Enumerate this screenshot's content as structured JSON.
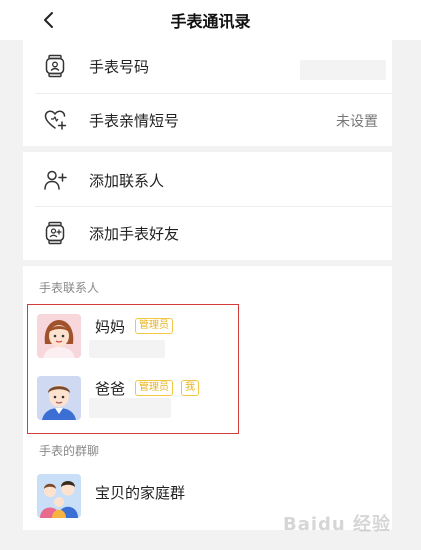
{
  "header": {
    "title": "手表通讯录"
  },
  "settings": {
    "watch_number_label": "手表号码",
    "family_short_number_label": "手表亲情短号",
    "family_short_number_value": "未设置"
  },
  "actions": {
    "add_contact_label": "添加联系人",
    "add_watch_friend_label": "添加手表好友"
  },
  "contacts": {
    "section_title": "手表联系人",
    "items": [
      {
        "name": "妈妈",
        "badges": [
          "管理员"
        ]
      },
      {
        "name": "爸爸",
        "badges": [
          "管理员",
          "我"
        ]
      }
    ]
  },
  "groups": {
    "section_title": "手表的群聊",
    "items": [
      {
        "name": "宝贝的家庭群"
      }
    ]
  },
  "watermark": "Baidu 经验",
  "colors": {
    "accent_badge": "#f2c744",
    "highlight_border": "#d43b3b",
    "background": "#f2f2f2"
  }
}
